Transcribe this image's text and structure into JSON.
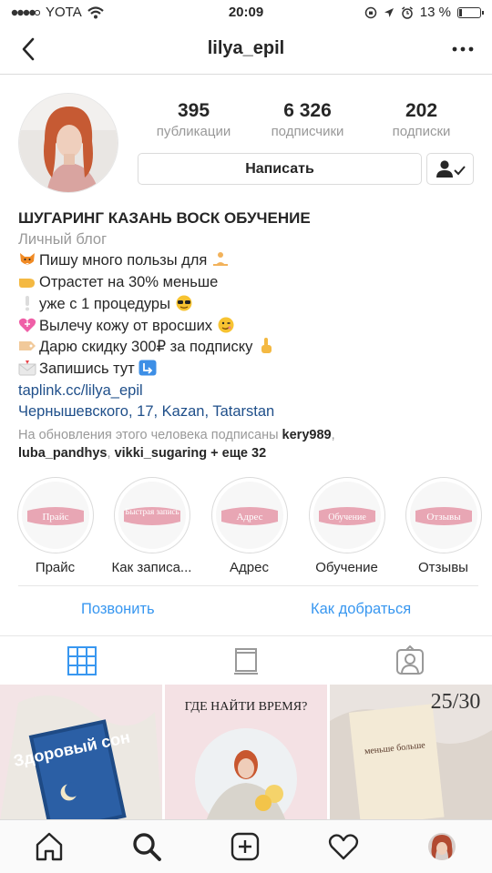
{
  "status_bar": {
    "carrier": "YOTA",
    "time": "20:09",
    "battery_percent": "13 %",
    "battery_level": 0.13
  },
  "header": {
    "username": "lilya_epil",
    "back_icon": "chevron-left-icon",
    "more_icon": "ellipsis-icon"
  },
  "profile": {
    "stats": [
      {
        "value": "395",
        "label": "публикации"
      },
      {
        "value": "6 326",
        "label": "подписчики"
      },
      {
        "value": "202",
        "label": "подписки"
      }
    ],
    "message_button": "Написать",
    "follow_icon": "person-check-icon"
  },
  "bio": {
    "name": "ШУГАРИНГ КАЗАНЬ ВОСК ОБУЧЕНИЕ",
    "category": "Личный блог",
    "lines": [
      {
        "emoji": "fox-emoji",
        "text": "Пишу много пользы для"
      },
      {
        "emoji": "hand-emoji",
        "text": "Отрастет на 30% меньше"
      },
      {
        "emoji": "exclamation-emoji",
        "text": "уже с 1 процедуры"
      },
      {
        "emoji": "heart-emoji",
        "text": "Вылечу кожу от вросших"
      },
      {
        "emoji": "tag-emoji",
        "text": "Дарю скидку 300₽ за подписку"
      },
      {
        "emoji": "envelope-emoji",
        "text": "Запишись тут"
      }
    ],
    "link": "taplink.cc/lilya_epil",
    "address": "Чернышевского, 17, Kazan, Tatarstan",
    "followed_prefix": "На обновления этого человека подписаны",
    "followed_user_1": "kery989",
    "followed_user_2": "luba_pandhys",
    "followed_user_3": "vikki_sugaring",
    "followed_suffix": "+ еще 32"
  },
  "highlights": [
    {
      "label": "Прайс",
      "cover_text": "Прайс"
    },
    {
      "label": "Как записа...",
      "cover_text": "Быстрая запись"
    },
    {
      "label": "Адрес",
      "cover_text": "Адрес"
    },
    {
      "label": "Обучение",
      "cover_text": "Обучение"
    },
    {
      "label": "Отзывы",
      "cover_text": "Отзывы"
    }
  ],
  "actions": {
    "call": "Позвонить",
    "directions": "Как добраться"
  },
  "tabs": [
    {
      "icon": "grid-icon",
      "active": true
    },
    {
      "icon": "feed-icon",
      "active": false
    },
    {
      "icon": "tagged-icon",
      "active": false
    }
  ],
  "posts": [
    {
      "book_title": "Здоровый сон"
    },
    {
      "headline": "ГДЕ НАЙТИ ВРЕМЯ?"
    },
    {
      "counter": "25/30",
      "book_title": "меньше больше"
    }
  ],
  "bottom_bar": [
    {
      "icon": "home-icon"
    },
    {
      "icon": "search-icon"
    },
    {
      "icon": "add-post-icon"
    },
    {
      "icon": "heart-icon"
    },
    {
      "icon": "profile-avatar-icon"
    }
  ],
  "colors": {
    "link": "#1f4f8a",
    "action": "#3897f0",
    "muted": "#999999",
    "highlight_accent": "#e8a6b4"
  }
}
